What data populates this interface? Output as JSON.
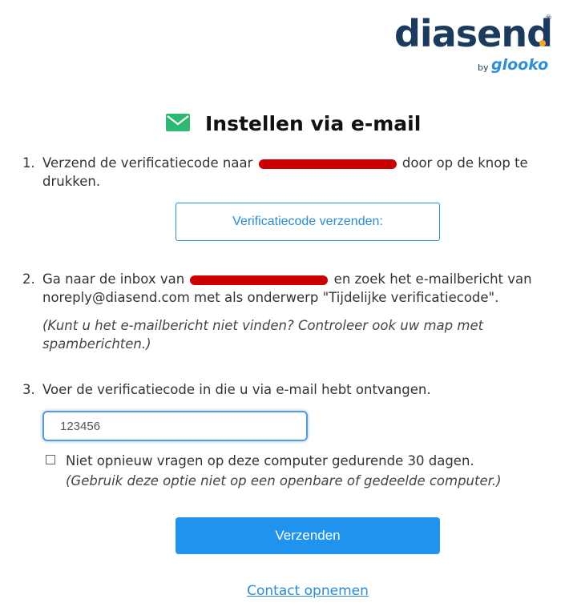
{
  "logo": {
    "brand": "diasend",
    "reg": "®",
    "by": "by",
    "partner": "glooko",
    "colors": {
      "brand": "#1b3a5e",
      "dot": "#f5a623",
      "partner": "#2f8fd6"
    }
  },
  "header": {
    "icon": "envelope-icon",
    "title": "Instellen via e-mail"
  },
  "step1": {
    "num": "1.",
    "text_before": "Verzend de verificatiecode naar",
    "text_after": "door op de knop te drukken.",
    "button_label": "Verificatiecode verzenden:"
  },
  "step2": {
    "num": "2.",
    "text_before": "Ga naar de inbox van",
    "text_after": "en zoek het e-mailbericht van noreply@diasend.com met als onderwerp \"Tijdelijke verificatiecode\".",
    "note": "(Kunt u het e-mailbericht niet vinden? Controleer ook uw map met spamberichten.)"
  },
  "step3": {
    "num": "3.",
    "text": "Voer de verificatiecode in die u via e-mail hebt ontvangen.",
    "code_value": "123456"
  },
  "remember": {
    "label": "Niet opnieuw vragen op deze computer gedurende 30 dagen.",
    "note": "(Gebruik deze optie niet op een openbare of gedeelde computer.)",
    "checked": false
  },
  "submit_label": "Verzenden",
  "contact_label": "Contact opnemen",
  "colors": {
    "accent": "#1f93ee",
    "link": "#2a8bd6",
    "redaction": "#cc0000",
    "icon_green": "#2eb872"
  }
}
